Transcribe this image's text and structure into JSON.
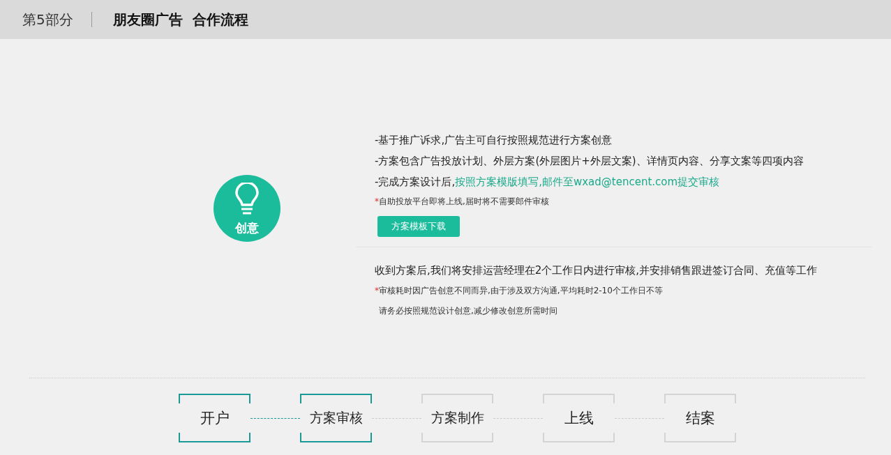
{
  "header": {
    "section": "第5部分",
    "title": "朋友圈广告  合作流程"
  },
  "stage": {
    "label": "创意"
  },
  "block1": {
    "lines": [
      {
        "parts": [
          {
            "text": "-基于推广诉求,广告主可自行按照规范进行方案创意",
            "highlight": false
          }
        ]
      },
      {
        "parts": [
          {
            "text": "-方案包含广告投放计划、外层方案(外层图片+外层文案)、详情页内容、分享文案等四项内容",
            "highlight": false
          }
        ]
      },
      {
        "parts": [
          {
            "text": "-完成方案设计后,",
            "highlight": false
          },
          {
            "text": "按照方案模版填写,邮件至wxad@tencent.com提交审核",
            "highlight": true
          }
        ]
      }
    ],
    "notes": [
      {
        "marker": "*",
        "text": "自助投放平台即将上线,届时将不需要郎件审核"
      }
    ],
    "button": "方案模板下载"
  },
  "block2": {
    "lines": [
      {
        "parts": [
          {
            "text": "收到方案后,我们将安排运营经理在2个工作日内进行审核,并安排销售跟进签订合同、充值等工作",
            "highlight": false
          }
        ]
      }
    ],
    "notes": [
      {
        "marker": "*",
        "text": "审核耗时因广告创意不同而异,由于涉及双方沟通,平均耗时2-10个工作日不等"
      },
      {
        "text": "请务必按照规范设计创意,减少修改创意所需时间"
      }
    ]
  },
  "steps": [
    {
      "label": "开户",
      "active": true
    },
    {
      "label": "方案审核",
      "active": true
    },
    {
      "label": "方案制作",
      "active": false
    },
    {
      "label": "上线",
      "active": false
    },
    {
      "label": "结案",
      "active": false
    }
  ]
}
